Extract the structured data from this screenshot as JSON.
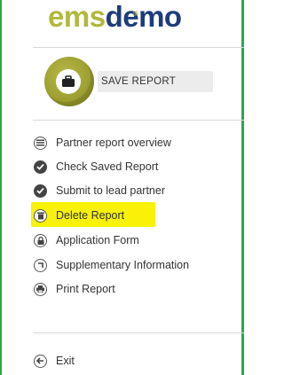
{
  "logo": {
    "part1": "ems",
    "part2": "demo",
    "registered": "®"
  },
  "save": {
    "label": "SAVE REPORT",
    "icon": "briefcase-icon"
  },
  "menu": [
    {
      "label": "Partner report overview",
      "icon": "list-icon"
    },
    {
      "label": "Check Saved Report",
      "icon": "check-icon"
    },
    {
      "label": "Submit to lead partner",
      "icon": "check-icon"
    },
    {
      "label": "Delete Report",
      "icon": "trash-icon",
      "highlighted": true
    },
    {
      "label": "Application Form",
      "icon": "lock-icon"
    },
    {
      "label": "Supplementary Information",
      "icon": "corner-arrow-icon"
    },
    {
      "label": "Print Report",
      "icon": "printer-icon"
    }
  ],
  "exit": {
    "label": "Exit",
    "icon": "back-arrow-icon"
  },
  "colors": {
    "frame": "#2aa84a",
    "highlight": "#f7f207",
    "logo_green": "#b1b83c",
    "logo_blue": "#1d3d7a",
    "save_olive": "#9c9e2f"
  }
}
